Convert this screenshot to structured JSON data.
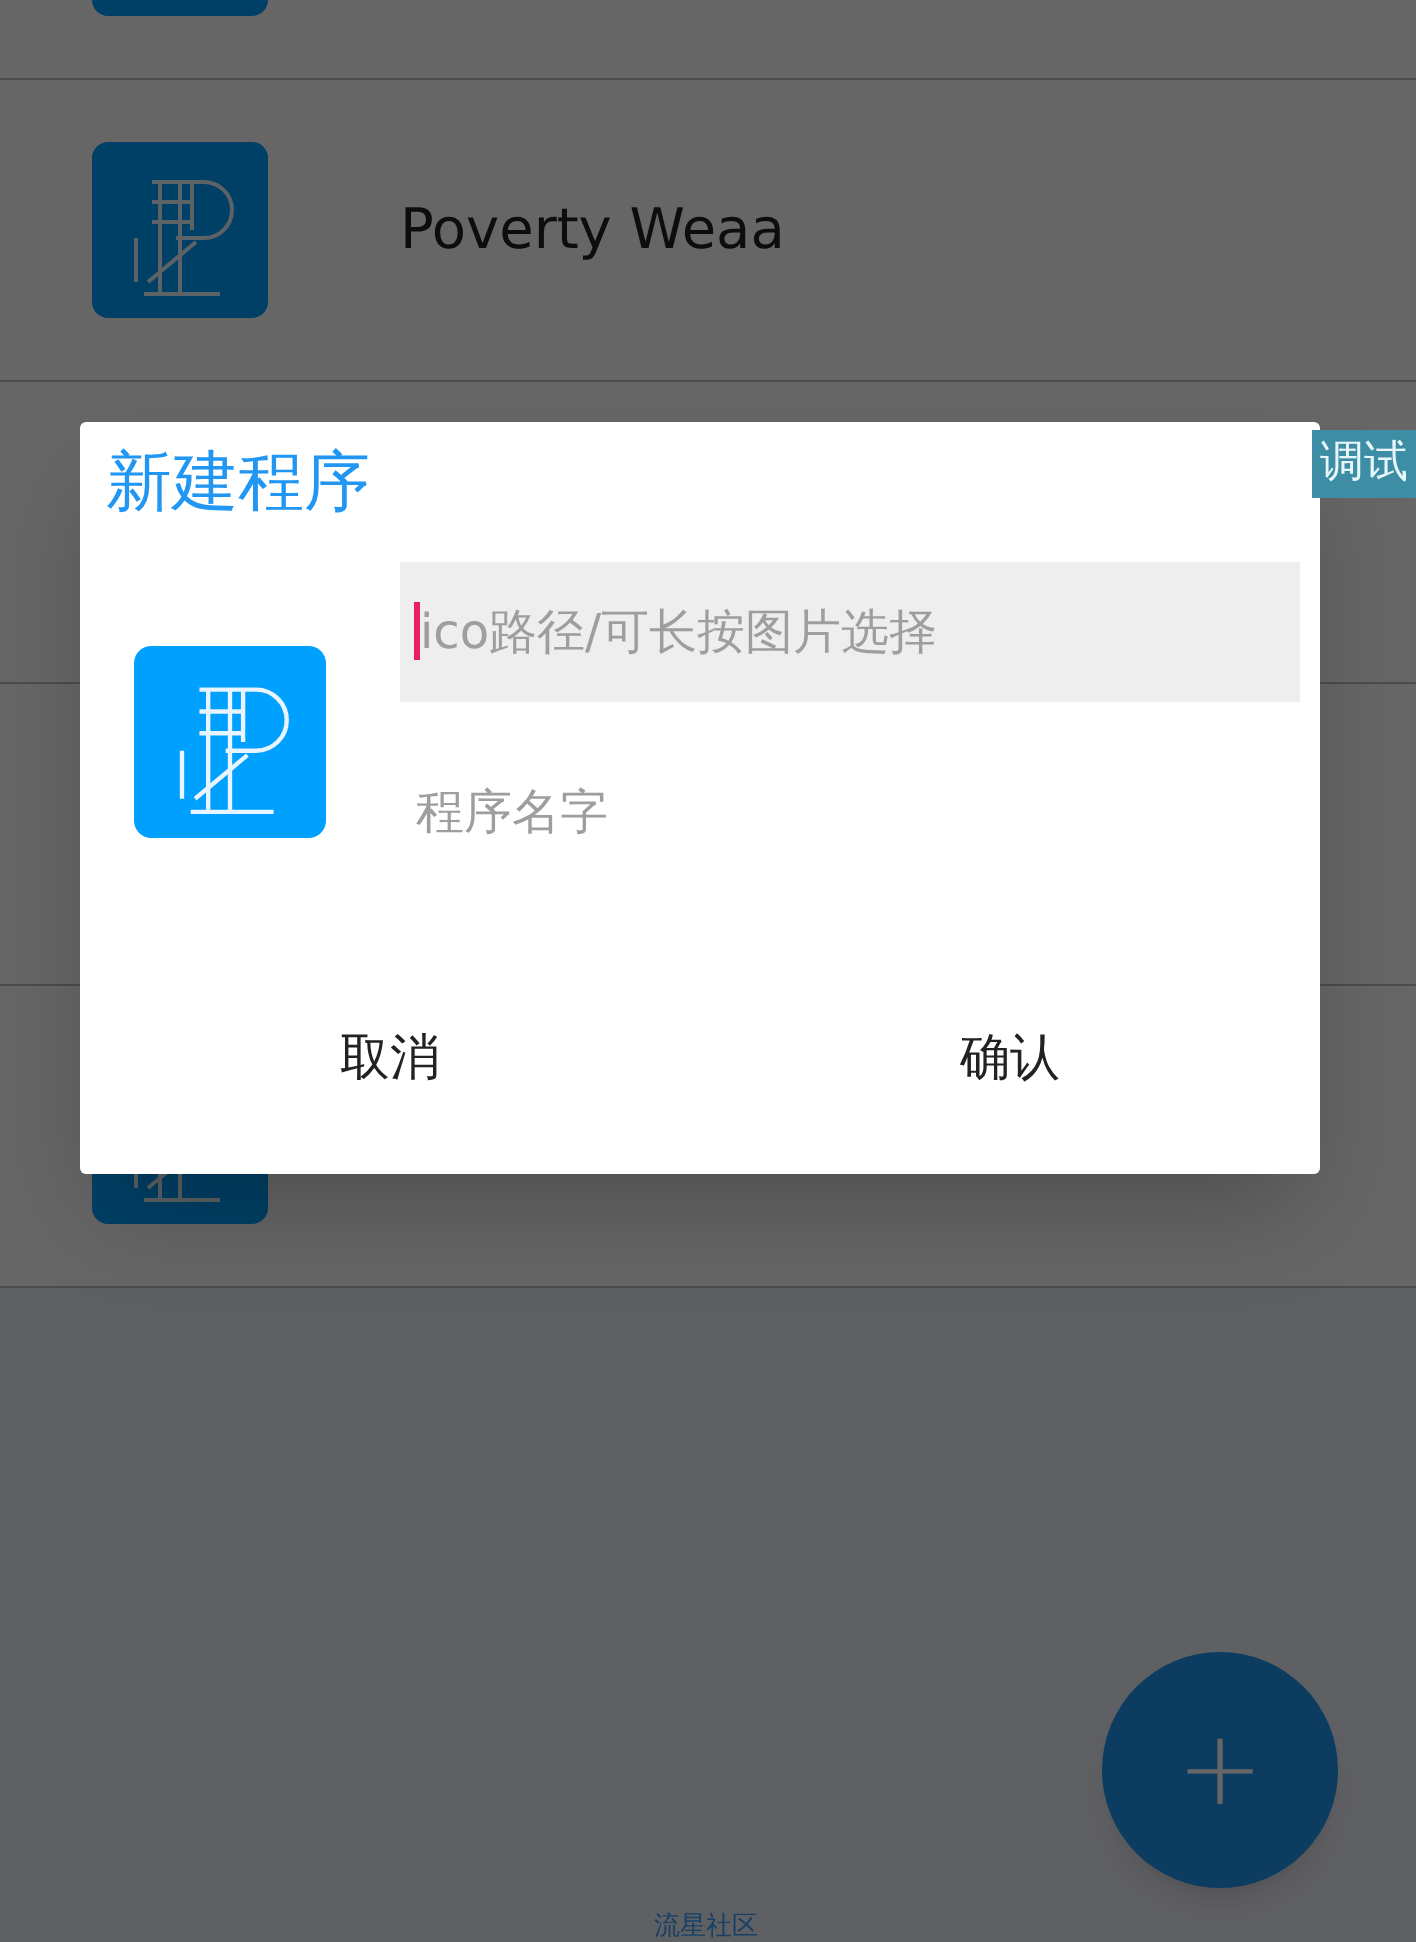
{
  "apps": [
    {
      "kind": "app"
    },
    {
      "kind": "app",
      "title": "Poverty Weaa"
    },
    {
      "kind": "row",
      "badge": "调试"
    },
    {
      "kind": "row"
    },
    {
      "kind": "app"
    }
  ],
  "footer": "流星社区",
  "fab": {
    "label": "+"
  },
  "dialog": {
    "title": "新建程序",
    "icon_path_field": {
      "placeholder": "ico路径/可长按图片选择",
      "focused": true
    },
    "name_field": {
      "placeholder": "程序名字"
    },
    "buttons": [
      {
        "label": "取消"
      },
      {
        "label": "确认"
      }
    ]
  }
}
